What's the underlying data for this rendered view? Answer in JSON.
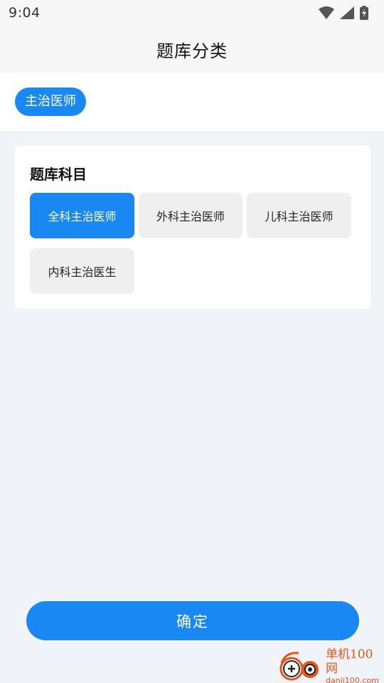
{
  "status_bar": {
    "time": "9:04",
    "icons": [
      "wifi-icon",
      "cellular-signal-icon",
      "battery-charging-icon"
    ]
  },
  "header": {
    "title": "题库分类"
  },
  "category": {
    "selected_label": "主治医师"
  },
  "subjects": {
    "title": "题库科目",
    "options": [
      {
        "label": "全科主治医师",
        "selected": true
      },
      {
        "label": "外科主治医师",
        "selected": false
      },
      {
        "label": "儿科主治医师",
        "selected": false
      },
      {
        "label": "内科主治医生",
        "selected": false
      }
    ]
  },
  "footer": {
    "confirm_label": "确定"
  },
  "watermark": {
    "name": "单机100网",
    "url": "danji100.com"
  },
  "colors": {
    "accent": "#1a88f2",
    "page_bg": "#f0f4f8",
    "chip_bg": "#efefef",
    "watermark": "#e2561d"
  }
}
